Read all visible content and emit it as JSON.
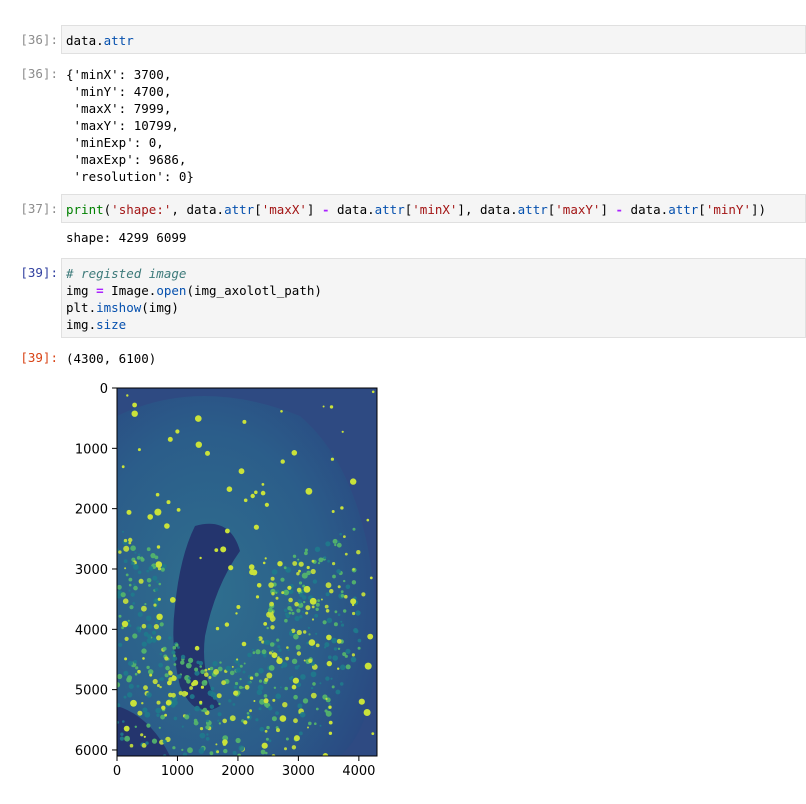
{
  "cells": [
    {
      "in_prompt": "[36]:",
      "code": {
        "obj": "data",
        "dot": ".",
        "attr": "attr"
      },
      "out_prompt": "[36]:",
      "output_lines": [
        "{'minX': 3700,",
        " 'minY': 4700,",
        " 'maxX': 7999,",
        " 'maxY': 10799,",
        " 'minExp': 0,",
        " 'maxExp': 9686,",
        " 'resolution': 0}"
      ]
    },
    {
      "in_prompt": "[37]:",
      "code": {
        "print": "print",
        "p1": "(",
        "s_shape": "'shape:'",
        "p2": ", data.",
        "a1": "attr",
        "p3": "[",
        "s_maxX": "'maxX'",
        "p4": "] ",
        "minus1": "-",
        "p5": " data.",
        "a2": "attr",
        "p6": "[",
        "s_minX": "'minX'",
        "p7": "], data.",
        "a3": "attr",
        "p8": "[",
        "s_maxY": "'maxY'",
        "p9": "] ",
        "minus2": "-",
        "p10": " data.",
        "a4": "attr",
        "p11": "[",
        "s_minY": "'minY'",
        "p12": "])"
      },
      "stdout": "shape: 4299 6099"
    },
    {
      "in_prompt": "[39]:",
      "code": {
        "comment": "# registed image",
        "l2_img": "img ",
        "l2_eq": "=",
        "l2_mid": " Image.",
        "l2_open": "open",
        "l2_arg": "(img_axolotl_path)",
        "l3_plt": "plt.",
        "l3_fn": "imshow",
        "l3_arg": "(img)",
        "l4_img": "img.",
        "l4_attr": "size"
      },
      "out_prompt": "[39]:",
      "output_text": "(4300, 6100)"
    }
  ],
  "chart_data": {
    "type": "image",
    "image_description_colormap": "viridis",
    "xlim": [
      0,
      4300
    ],
    "ylim": [
      6100,
      0
    ],
    "xticks": [
      0,
      1000,
      2000,
      3000,
      4000
    ],
    "yticks": [
      0,
      1000,
      2000,
      3000,
      4000,
      5000,
      6000
    ],
    "xtick_labels": [
      "0",
      "1000",
      "2000",
      "3000",
      "4000"
    ],
    "ytick_labels": [
      "0",
      "1000",
      "2000",
      "3000",
      "4000",
      "5000",
      "6000"
    ],
    "colors": {
      "background": "#2e4a82",
      "mid": "#1f7a8c",
      "bright": "#c9e23a",
      "dark": "#24356e"
    }
  }
}
